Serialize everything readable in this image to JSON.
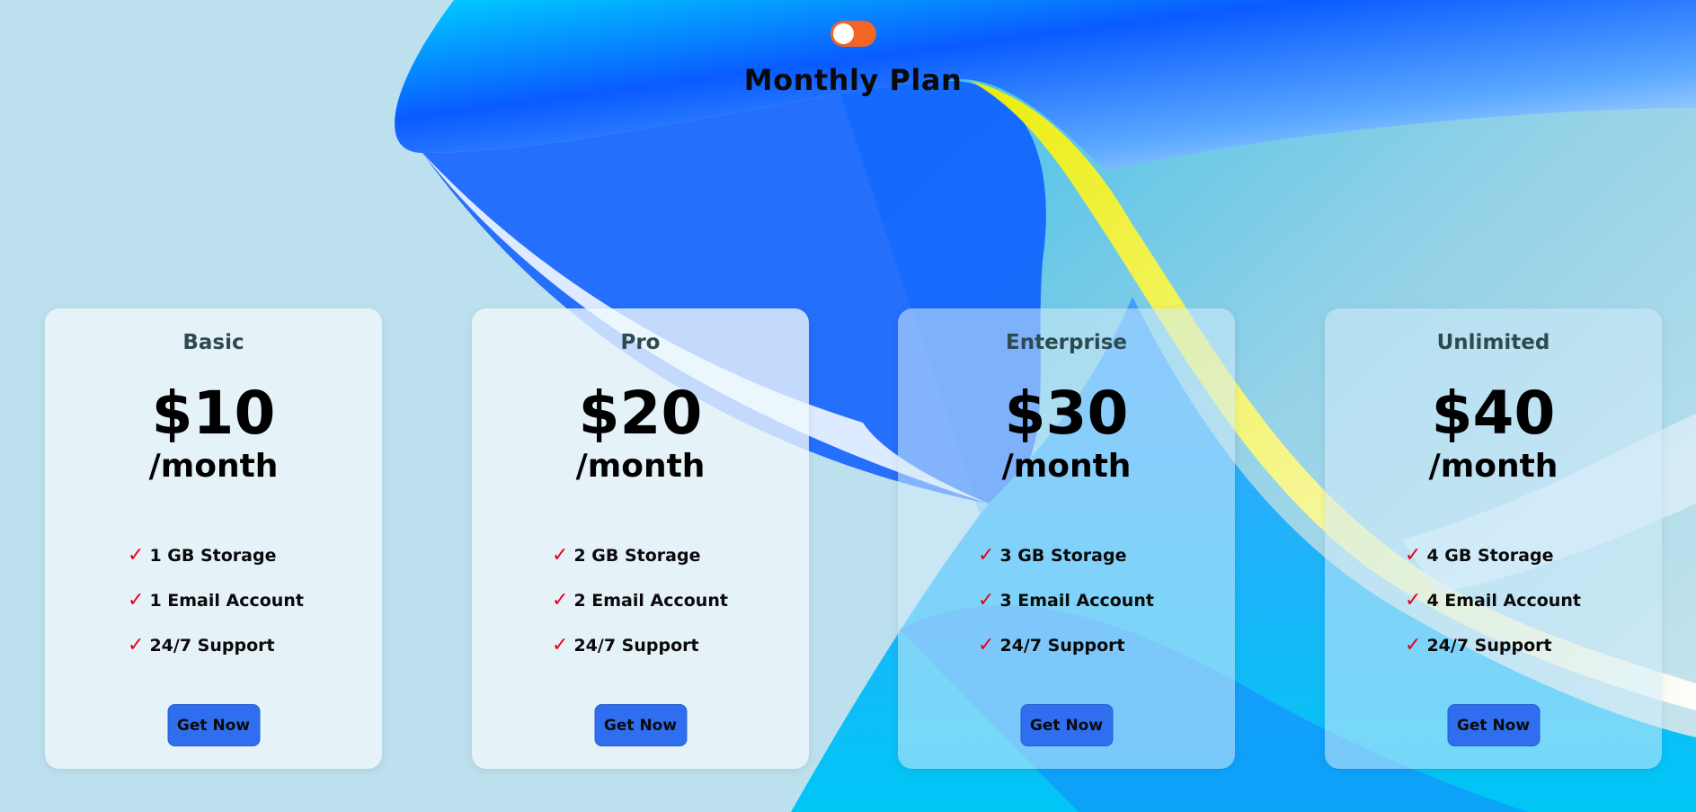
{
  "header": {
    "toggle_state": "monthly",
    "title": "Monthly Plan"
  },
  "colors": {
    "toggle": "#f26522",
    "button": "#2f6fef",
    "check": "#e8001c"
  },
  "plans": [
    {
      "name": "Basic",
      "price": "$10",
      "period": "/month",
      "features": [
        "1 GB Storage",
        "1 Email Account",
        "24/7 Support"
      ],
      "cta": "Get Now"
    },
    {
      "name": "Pro",
      "price": "$20",
      "period": "/month",
      "features": [
        "2 GB Storage",
        "2 Email Account",
        "24/7 Support"
      ],
      "cta": "Get Now"
    },
    {
      "name": "Enterprise",
      "price": "$30",
      "period": "/month",
      "features": [
        "3 GB Storage",
        "3 Email Account",
        "24/7 Support"
      ],
      "cta": "Get Now"
    },
    {
      "name": "Unlimited",
      "price": "$40",
      "period": "/month",
      "features": [
        "4 GB Storage",
        "4 Email Account",
        "24/7 Support"
      ],
      "cta": "Get Now"
    }
  ],
  "icons": {
    "check": "check-icon"
  }
}
